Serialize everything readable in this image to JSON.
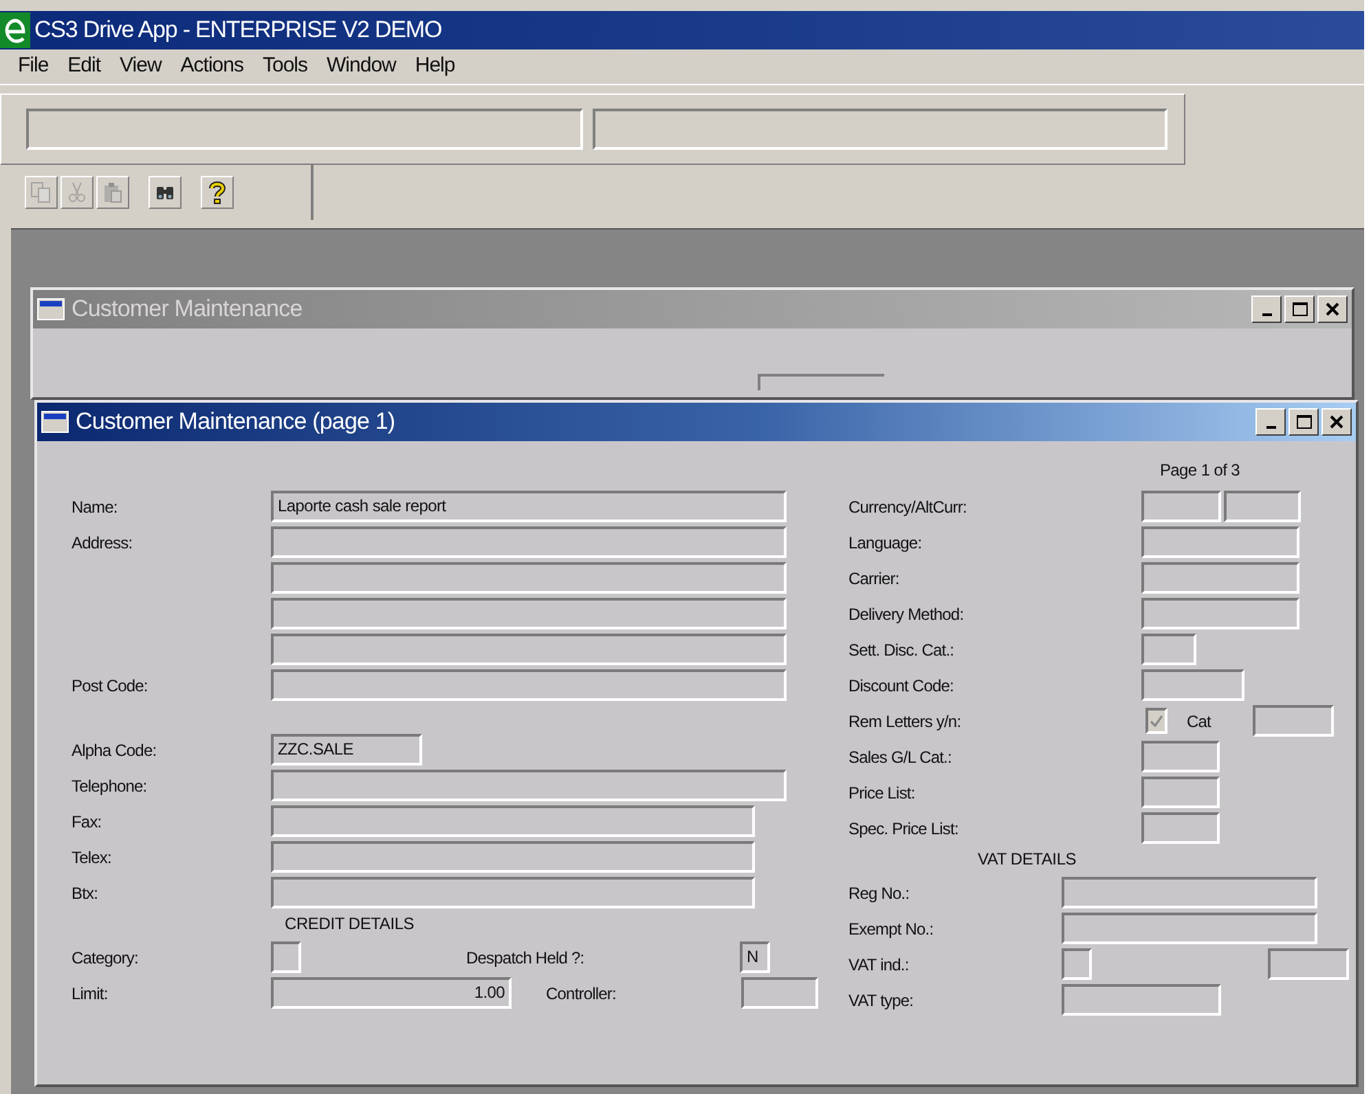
{
  "app": {
    "title": "CS3 Drive App - ENTERPRISE V2 DEMO"
  },
  "menu": [
    {
      "label": "File"
    },
    {
      "label": "Edit"
    },
    {
      "label": "View"
    },
    {
      "label": "Actions"
    },
    {
      "label": "Tools"
    },
    {
      "label": "Window"
    },
    {
      "label": "Help"
    }
  ],
  "toolbar": [
    {
      "kind": "copy",
      "disabled": true
    },
    {
      "kind": "cut",
      "disabled": true
    },
    {
      "kind": "paste",
      "disabled": true
    },
    {
      "kind": "find",
      "disabled": false
    },
    {
      "kind": "help",
      "disabled": false
    }
  ],
  "back_window": {
    "title": "Customer Maintenance",
    "active": false
  },
  "window": {
    "title": "Customer Maintenance (page 1)",
    "active": true,
    "page": "Page 1 of 3",
    "left": [
      {
        "rows": [
          {
            "label": "Name:",
            "items": [
              {
                "kind": "field",
                "value": "Laporte cash sale report"
              }
            ]
          },
          {
            "label": "Address:",
            "items": [
              {
                "kind": "field"
              }
            ]
          },
          {
            "items": [
              {
                "kind": "field"
              }
            ]
          },
          {
            "items": [
              {
                "kind": "field"
              }
            ]
          },
          {
            "items": [
              {
                "kind": "field"
              }
            ]
          },
          {
            "label": "Post Code:",
            "items": [
              {
                "kind": "field"
              }
            ]
          }
        ]
      },
      {
        "rows": [
          {
            "label": "Alpha Code:",
            "items": [
              {
                "kind": "field",
                "value": "ZZC.SALE"
              }
            ]
          },
          {
            "label": "Telephone:",
            "items": [
              {
                "kind": "field"
              }
            ]
          },
          {
            "label": "Fax:",
            "items": [
              {
                "kind": "field"
              }
            ]
          },
          {
            "label": "Telex:",
            "items": [
              {
                "kind": "field"
              }
            ]
          },
          {
            "label": "Btx:",
            "items": [
              {
                "kind": "field"
              }
            ]
          }
        ]
      },
      {
        "heading": "CREDIT DETAILS",
        "rows": [
          {
            "label": "Category:",
            "items": [
              {
                "kind": "field"
              },
              {
                "kind": "label",
                "text": "Despatch Held ?:"
              },
              {
                "kind": "field",
                "value": "N"
              }
            ]
          },
          {
            "label": "Limit:",
            "items": [
              {
                "kind": "number",
                "value": "1.00"
              },
              {
                "kind": "label",
                "text": "Controller:"
              },
              {
                "kind": "field"
              }
            ]
          }
        ]
      }
    ],
    "right": [
      {
        "rows": [
          {
            "label": "Currency/AltCurr:",
            "items": [
              {
                "kind": "field"
              },
              {
                "kind": "field"
              }
            ]
          },
          {
            "label": "Language:",
            "items": [
              {
                "kind": "field"
              }
            ]
          },
          {
            "label": "Carrier:",
            "items": [
              {
                "kind": "field"
              }
            ]
          },
          {
            "label": "Delivery Method:",
            "items": [
              {
                "kind": "field"
              }
            ]
          },
          {
            "label": "Sett. Disc. Cat.:",
            "items": [
              {
                "kind": "field"
              }
            ]
          },
          {
            "label": "Discount Code:",
            "items": [
              {
                "kind": "field"
              }
            ]
          },
          {
            "label": "Rem Letters y/n:",
            "items": [
              {
                "kind": "check",
                "checked": true,
                "disabled": true
              },
              {
                "kind": "label",
                "text": "Cat"
              },
              {
                "kind": "field"
              }
            ]
          },
          {
            "label": "Sales G/L Cat.:",
            "items": [
              {
                "kind": "field"
              }
            ]
          },
          {
            "label": "Price List:",
            "items": [
              {
                "kind": "field"
              }
            ]
          },
          {
            "label": "Spec. Price List:",
            "items": [
              {
                "kind": "field"
              }
            ]
          }
        ]
      },
      {
        "heading": "VAT DETAILS",
        "rows": [
          {
            "label": "Reg No.:",
            "items": [
              {
                "kind": "field"
              }
            ]
          },
          {
            "label": "Exempt No.:",
            "items": [
              {
                "kind": "field"
              }
            ]
          },
          {
            "label": "VAT ind.:",
            "items": [
              {
                "kind": "field"
              },
              {
                "kind": "field"
              }
            ]
          },
          {
            "label": "VAT type:",
            "items": [
              {
                "kind": "field"
              }
            ]
          }
        ]
      }
    ]
  }
}
